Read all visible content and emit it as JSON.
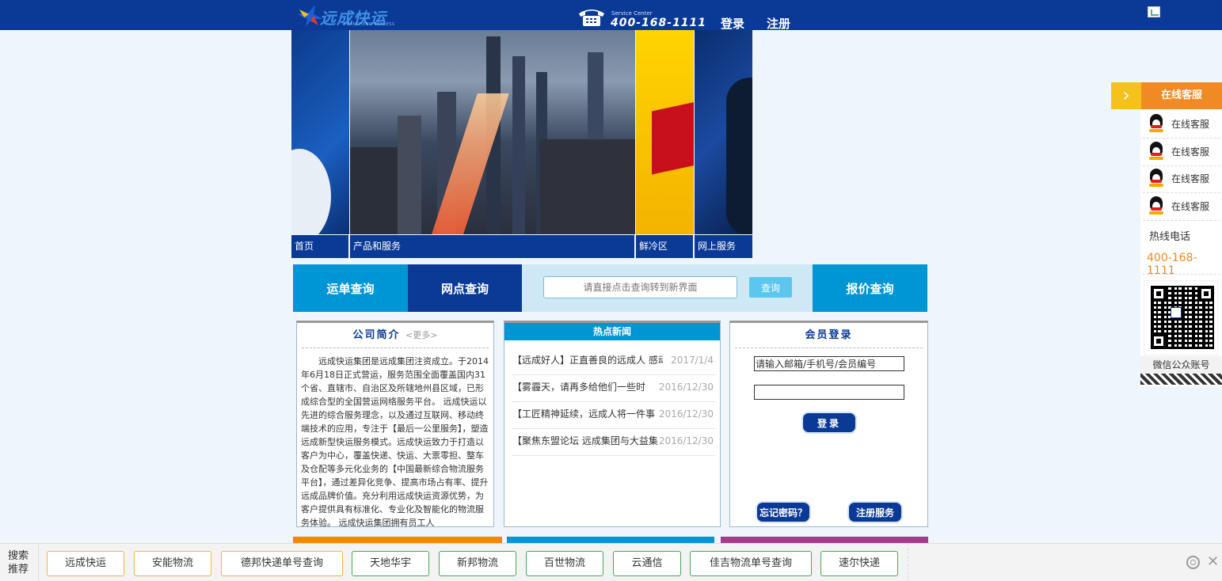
{
  "header": {
    "logo_text": "远成快运",
    "logo_sub": "YUANCHENG EXPRESS",
    "service_label": "Service Center",
    "service_number": "400-168-1111",
    "login": "登录",
    "register": "注册"
  },
  "banner_nav": [
    "首页",
    "产品和服务",
    "鲜冷区",
    "网上服务"
  ],
  "query": {
    "waybill": "运单查询",
    "branch": "网点查询",
    "placeholder": "请直接点击查询转到新界面",
    "button": "查询",
    "price": "报价查询"
  },
  "about": {
    "title": "公司简介",
    "more": "<更多>",
    "text": "远成快运集团是远成集团注资成立。于2014年6月18日正式营运，服务范围全面覆盖国内31个省、直辖市、自治区及所辖地州县区域，已形成综合型的全国营运网络服务平台。 远成快运以先进的综合服务理念，以及通过互联网、移动终端技术的应用，专注于【最后一公里服务】，塑造远成新型快运服务模式。远成快运致力于打造以客户为中心，覆盖快递、快运、大票零担、整车及仓配等多元化业务的【中国最新综合物流服务平台】，通过差异化竞争、提高市场占有率、提升远成品牌价值。充分利用远成快运资源优势，为客户提供具有标准化、专业化及智能化的物流服务体验。 远成快运集团拥有员工人"
  },
  "news": {
    "title": "热点新闻",
    "items": [
      {
        "title": "【远成好人】正直善良的远成人 感动",
        "date": "2017/1/4"
      },
      {
        "title": "【雾霾天，请再多给他们一些时",
        "date": "2016/12/30"
      },
      {
        "title": "【工匠精神延续，远成人将一件事",
        "date": "2016/12/30"
      },
      {
        "title": "【聚焦东盟论坛 远成集团与大益集",
        "date": "2016/12/30"
      }
    ]
  },
  "member": {
    "title": "会员登录",
    "username_value": "请输入邮箱/手机号/会员编号",
    "password_value": "",
    "login_button": "登录",
    "forgot_button": "忘记密码？",
    "register_button": "注册服务"
  },
  "side_panel": {
    "arrow": "›",
    "title": "在线客服",
    "qq_items": [
      "在线客服",
      "在线客服",
      "在线客服",
      "在线客服"
    ],
    "hotline_label": "热线电话",
    "hotline_number": "400-168-1111",
    "wechat_label": "微信公众账号"
  },
  "bottom_bar": {
    "label": "搜索推荐",
    "chips": [
      "远成快运",
      "安能物流",
      "德邦快递单号查询",
      "天地华宇",
      "新邦物流",
      "百世物流",
      "云通信",
      "佳吉物流单号查询",
      "速尔快递"
    ],
    "close": "✕"
  },
  "colors": {
    "brand_blue": "#0a3a96",
    "accent_cyan": "#0095d4",
    "accent_orange": "#f08a23",
    "accent_yellow": "#f5c21c"
  }
}
